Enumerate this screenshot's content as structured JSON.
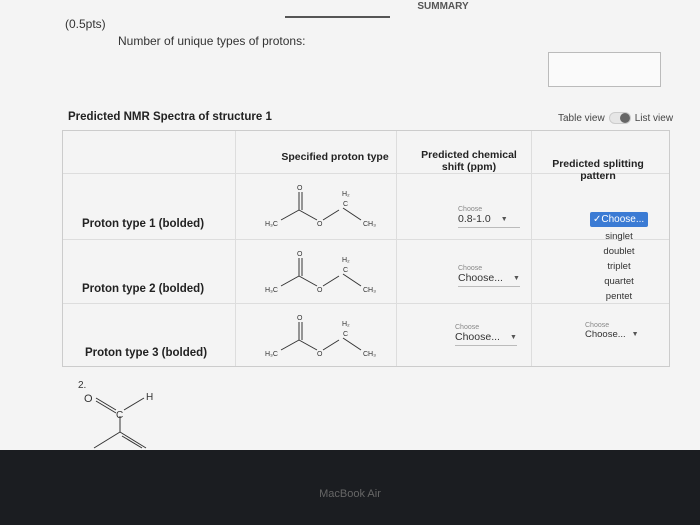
{
  "nav": {
    "tab_left": "...",
    "tab_summary": "SUMMARY"
  },
  "question": {
    "points": "(0.5pts)",
    "text": "Number of unique types of protons:",
    "answer_value": ""
  },
  "nmr": {
    "title": "Predicted NMR Spectra of structure 1",
    "view_table": "Table view",
    "view_list": "List view",
    "headers": {
      "proton_type": "Specified proton type",
      "chemical_shift": "Predicted chemical shift (ppm)",
      "splitting": "Predicted splitting pattern"
    },
    "rows": [
      {
        "label": "Proton type 1 (bolded)",
        "shift_hint": "Choose",
        "shift_value": "0.8-1.0",
        "split_value": "Choose..."
      },
      {
        "label": "Proton type 2 (bolded)",
        "shift_hint": "Choose",
        "shift_value": "Choose...",
        "split_hint": ""
      },
      {
        "label": "Proton type 3 (bolded)",
        "shift_hint": "Choose",
        "shift_value": "Choose...",
        "split_hint": "Choose",
        "split_value": "Choose..."
      }
    ],
    "splitting_options": [
      "singlet",
      "doublet",
      "triplet",
      "quartet",
      "pentet"
    ],
    "molecule": {
      "h3c": "H₃C",
      "ch3": "CH₃",
      "h2": "H₂",
      "c": "C",
      "o": "O"
    }
  },
  "question2": {
    "number": "2.",
    "o": "O",
    "c": "C",
    "h": "H"
  },
  "device": {
    "brand": "MacBook Air"
  },
  "colors": {
    "accent": "#3b7bd4",
    "bezel": "#1b1d21"
  }
}
